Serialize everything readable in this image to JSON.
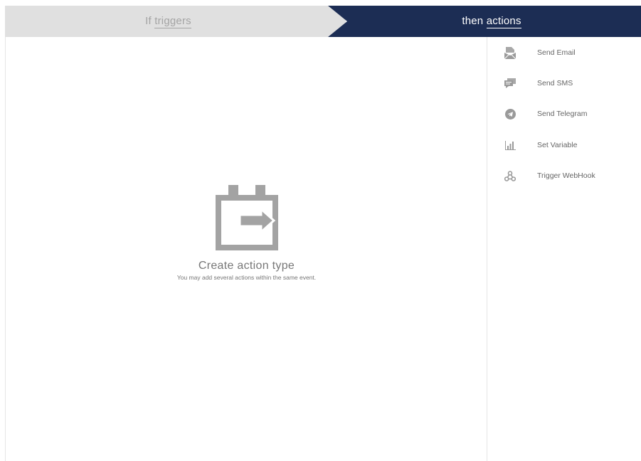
{
  "steps": {
    "left": {
      "prefix": "If ",
      "emphasis": "triggers"
    },
    "right": {
      "prefix": "then ",
      "emphasis": "actions"
    }
  },
  "main": {
    "empty_icon": "calendar-arrow-icon",
    "title": "Create action type",
    "subtitle": "You may add several actions within the same event."
  },
  "actions": {
    "items": [
      {
        "icon": "email-icon",
        "label": "Send Email"
      },
      {
        "icon": "sms-icon",
        "label": "Send SMS"
      },
      {
        "icon": "telegram-icon",
        "label": "Send Telegram"
      },
      {
        "icon": "bar-chart-icon",
        "label": "Set Variable"
      },
      {
        "icon": "webhook-icon",
        "label": "Trigger WebHook"
      }
    ]
  },
  "colors": {
    "header_dark": "#1c2d54",
    "header_light": "#e0e0e0",
    "icon_gray": "#9a9a9a"
  }
}
